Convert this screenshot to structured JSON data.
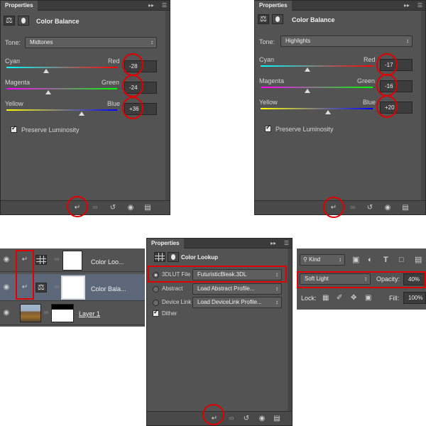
{
  "panel_tl": {
    "tab": "Properties",
    "title": "Color Balance",
    "tone_label": "Tone:",
    "tone_value": "Midtones",
    "sliders": [
      {
        "left": "Cyan",
        "right": "Red",
        "value": "-28",
        "fraction": 0.36
      },
      {
        "left": "Magenta",
        "right": "Green",
        "value": "-24",
        "fraction": 0.38
      },
      {
        "left": "Yellow",
        "right": "Blue",
        "value": "+36",
        "fraction": 0.68
      }
    ],
    "preserve": "Preserve Luminosity"
  },
  "panel_tr": {
    "tab": "Properties",
    "title": "Color Balance",
    "tone_label": "Tone:",
    "tone_value": "Highlights",
    "sliders": [
      {
        "left": "Cyan",
        "right": "Red",
        "value": "-17",
        "fraction": 0.42
      },
      {
        "left": "Magenta",
        "right": "Green",
        "value": "-16",
        "fraction": 0.42
      },
      {
        "left": "Yellow",
        "right": "Blue",
        "value": "+20",
        "fraction": 0.6
      }
    ],
    "preserve": "Preserve Luminosity"
  },
  "layers": [
    {
      "name": "Color Loo..."
    },
    {
      "name": "Color Bala..."
    },
    {
      "name": "Layer 1"
    }
  ],
  "panel_lookup": {
    "tab": "Properties",
    "title": "Color Lookup",
    "rows": [
      {
        "label": "3DLUT File",
        "value": "FuturisticBleak.3DL",
        "selected": true
      },
      {
        "label": "Abstract",
        "value": "Load Abstract Profile...",
        "selected": false
      },
      {
        "label": "Device Link",
        "value": "Load DeviceLink Profile...",
        "selected": false
      }
    ],
    "dither": "Dither"
  },
  "layer_options": {
    "kind": "Kind",
    "blend_mode": "Soft Light",
    "opacity_label": "Opacity:",
    "opacity_value": "40%",
    "lock_label": "Lock:",
    "fill_label": "Fill:",
    "fill_value": "100%"
  },
  "colors": {
    "panel": "#535353",
    "highlight": "#e00000",
    "selected_layer": "#5c6779"
  }
}
